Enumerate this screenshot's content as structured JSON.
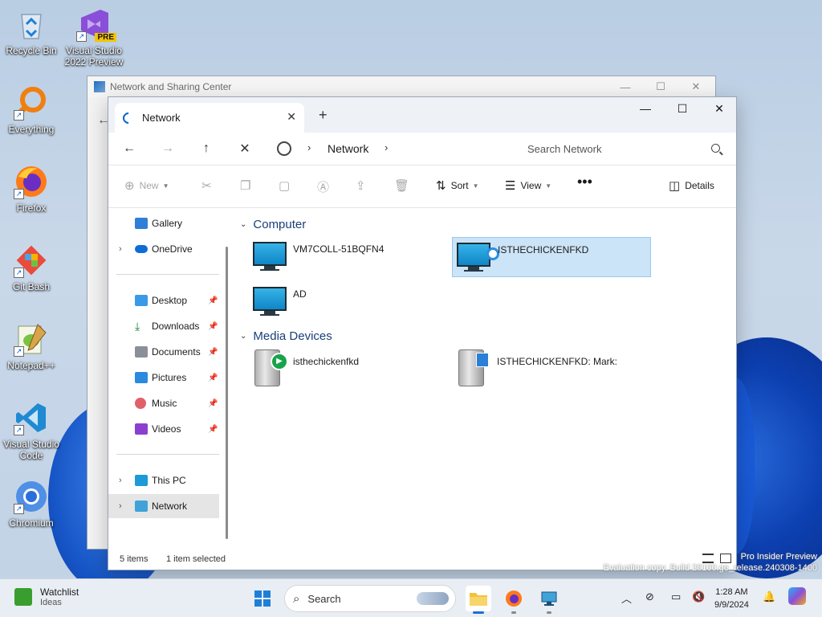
{
  "desktop": {
    "icons": [
      {
        "label": "Recycle Bin"
      },
      {
        "label": "Visual Studio 2022 Preview",
        "badge": "PRE"
      },
      {
        "label": "Everything"
      },
      {
        "label": "Firefox"
      },
      {
        "label": "Git Bash"
      },
      {
        "label": "Notepad++"
      },
      {
        "label": "Visual Studio Code"
      },
      {
        "label": "Chromium"
      }
    ],
    "watermark_line1": "Pro Insider Preview",
    "watermark_line2": "Evaluation copy. Build 26100.ge_release.240308-1400"
  },
  "back_window": {
    "title": "Network and Sharing Center"
  },
  "explorer": {
    "tab_title": "Network",
    "address": {
      "crumb": "Network"
    },
    "search": {
      "placeholder": "Search Network"
    },
    "commands": {
      "new": "New",
      "sort": "Sort",
      "view": "View",
      "details": "Details"
    },
    "sidebar": {
      "gallery": "Gallery",
      "onedrive": "OneDrive",
      "desktop": "Desktop",
      "downloads": "Downloads",
      "documents": "Documents",
      "pictures": "Pictures",
      "music": "Music",
      "videos": "Videos",
      "thispc": "This PC",
      "network": "Network"
    },
    "groups": {
      "computer": {
        "title": "Computer",
        "items": [
          "VM7COLL-51BQFN4",
          "ISTHECHICKENFKD",
          "AD"
        ]
      },
      "media": {
        "title": "Media Devices",
        "items": [
          "isthechickenfkd",
          "ISTHECHICKENFKD: Mark:"
        ]
      }
    },
    "status": {
      "count": "5 items",
      "selected": "1 item selected"
    }
  },
  "taskbar": {
    "widget_title": "Watchlist",
    "widget_sub": "Ideas",
    "search_label": "Search",
    "time": "1:28 AM",
    "date": "9/9/2024"
  }
}
